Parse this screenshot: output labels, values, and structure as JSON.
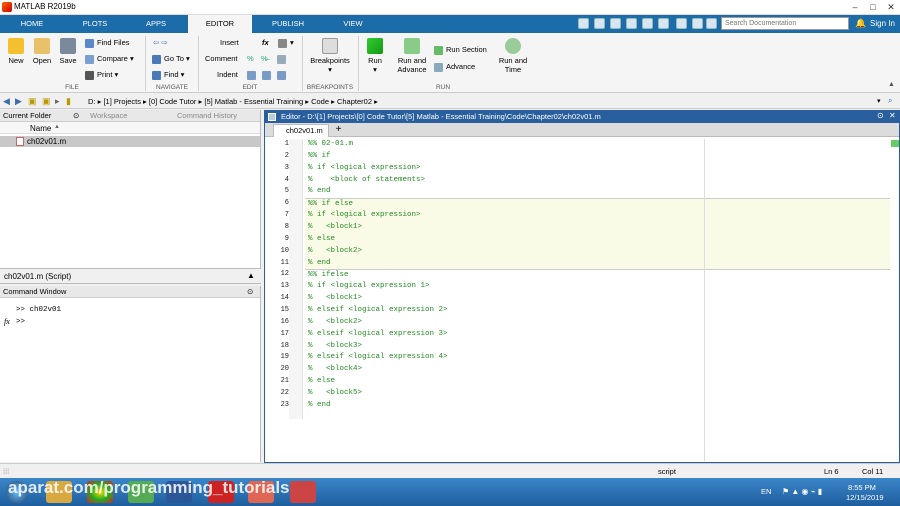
{
  "window": {
    "title": "MATLAB R2019b"
  },
  "tabs": [
    "HOME",
    "PLOTS",
    "APPS",
    "EDITOR",
    "PUBLISH",
    "VIEW"
  ],
  "search": {
    "placeholder": "Search Documentation"
  },
  "signin": "Sign In",
  "ribbon": {
    "file": {
      "new": "New",
      "open": "Open",
      "save": "Save",
      "find_files": "Find Files",
      "compare": "Compare",
      "print": "Print",
      "group": "FILE"
    },
    "navigate": {
      "goto": "Go To",
      "find": "Find",
      "group": "NAVIGATE"
    },
    "edit": {
      "insert": "Insert",
      "comment": "Comment",
      "indent": "Indent",
      "fx": "fx",
      "group": "EDIT"
    },
    "breakpoints": {
      "label": "Breakpoints",
      "group": "BREAKPOINTS"
    },
    "run": {
      "run": "Run",
      "run_advance_1": "Run and",
      "run_advance_2": "Advance",
      "run_section": "Run Section",
      "advance": "Advance",
      "run_time_1": "Run and",
      "run_time_2": "Time",
      "group": "RUN"
    }
  },
  "address": {
    "path": [
      "D:",
      "[1] Projects",
      "[0] Code Tutor",
      "[5] Matlab - Essential Training",
      "Code",
      "Chapter02"
    ]
  },
  "current_folder": {
    "title": "Current Folder",
    "workspace": "Workspace",
    "history": "Command History",
    "name_header": "Name",
    "files": [
      "ch02v01.m"
    ]
  },
  "details": {
    "label": "ch02v01.m  (Script)"
  },
  "command_window": {
    "title": "Command Window",
    "lines": [
      ">>  ch02v01",
      ">>"
    ],
    "fx": "fx"
  },
  "editor": {
    "title": "Editor - D:\\[1] Projects\\[0] Code Tutor\\[5] Matlab - Essential Training\\Code\\Chapter02\\ch02v01.m",
    "tab": "ch02v01.m",
    "add_tab": "+",
    "lines": [
      "%% 02-01.m",
      "%% if",
      "% if <logical expression>",
      "%    <block of statements>",
      "% end",
      "%% if else",
      "% if <logical expression>",
      "%   <block1>",
      "% else",
      "%   <block2>",
      "% end",
      "%% ifelse",
      "% if <logical expression 1>",
      "%   <block1>",
      "% elseif <logical expression 2>",
      "%   <block2>",
      "% elseif <logical expression 3>",
      "%   <block3>",
      "% elseif <logical expression 4>",
      "%   <block4>",
      "% else",
      "%   <block5>",
      "% end"
    ],
    "highlighted_cell": [
      6,
      11
    ]
  },
  "statusbar": {
    "mode": "script",
    "ln": "Ln  6",
    "col": "Col  11"
  },
  "taskbar": {
    "lang": "EN",
    "time": "8:55 PM",
    "date": "12/15/2019"
  },
  "watermark": "aparat.com/programming_tutorials",
  "colors": {
    "accent": "#1b6ca8",
    "comment": "#228b22",
    "cell": "#fafbe6"
  }
}
